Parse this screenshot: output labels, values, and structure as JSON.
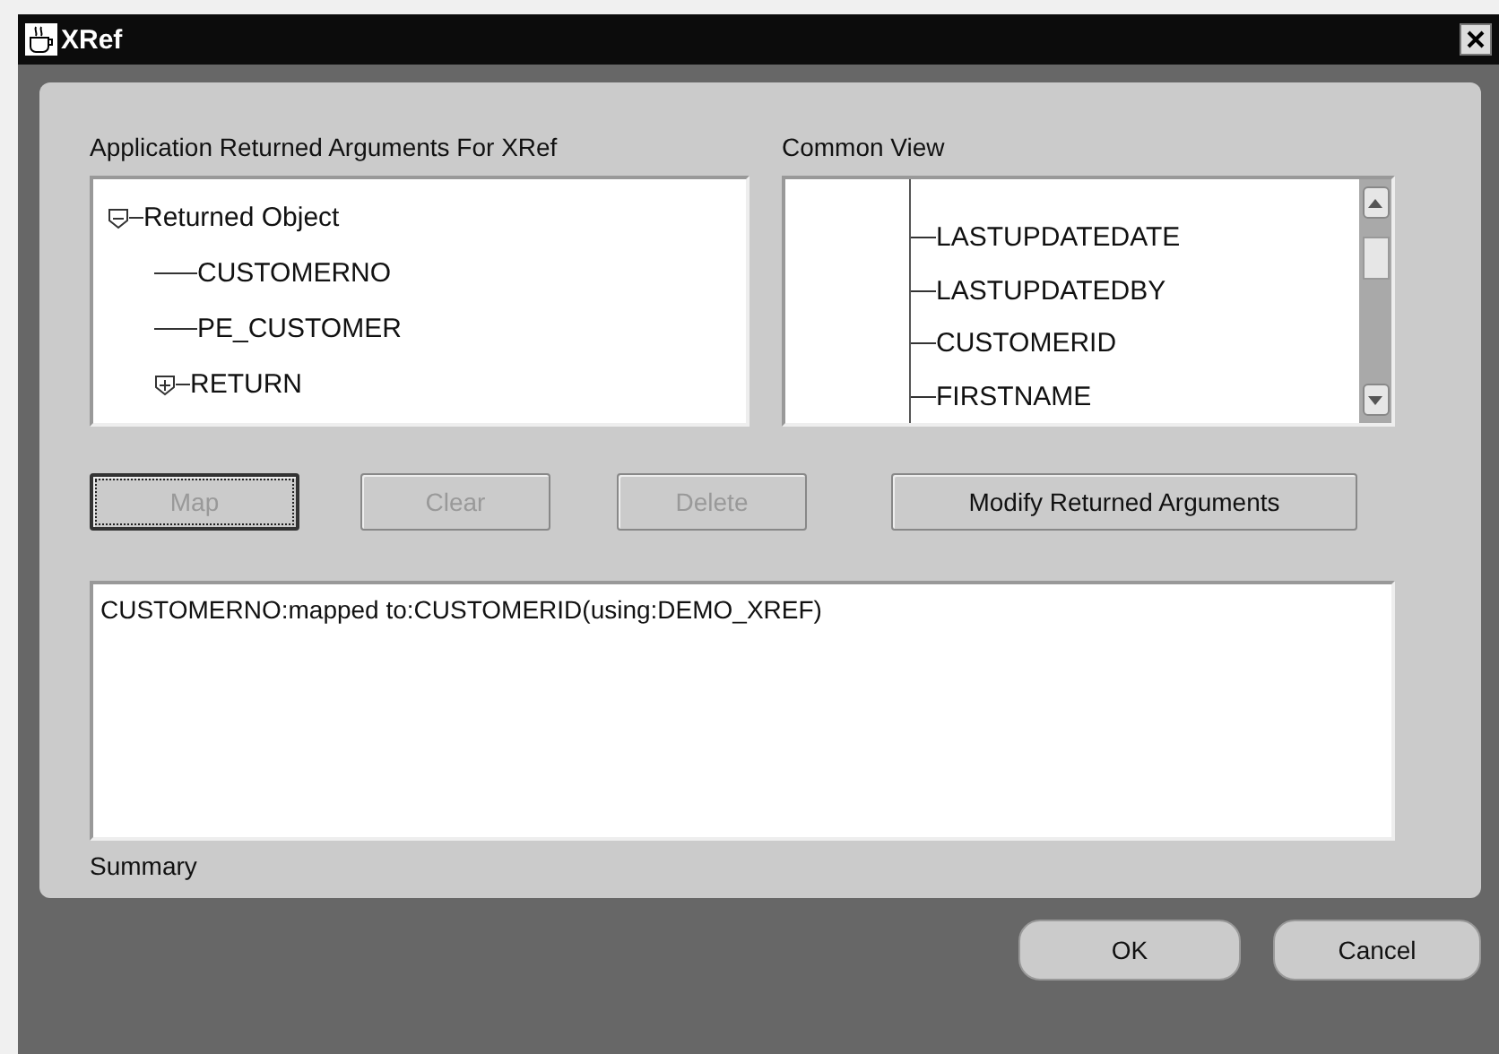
{
  "window": {
    "title": "XRef"
  },
  "left_tree": {
    "label": "Application Returned Arguments For XRef",
    "items": [
      {
        "label": "Returned Object",
        "kind": "folder",
        "expanded": true,
        "children": [
          {
            "label": "CUSTOMERNO",
            "kind": "leaf"
          },
          {
            "label": "PE_CUSTOMER",
            "kind": "leaf"
          },
          {
            "label": "RETURN",
            "kind": "folder",
            "expanded": false
          }
        ]
      }
    ]
  },
  "common_view": {
    "label": "Common View",
    "items": [
      {
        "label": "LASTUPDATEDATE"
      },
      {
        "label": "LASTUPDATEDBY"
      },
      {
        "label": "CUSTOMERID"
      },
      {
        "label": "FIRSTNAME"
      }
    ]
  },
  "actions": [
    {
      "label": "Map",
      "disabled": true,
      "focused": true
    },
    {
      "label": "Clear",
      "disabled": true,
      "focused": false
    },
    {
      "label": "Delete",
      "disabled": true,
      "focused": false
    },
    {
      "label": "Modify Returned Arguments",
      "disabled": false,
      "focused": false
    }
  ],
  "summary": {
    "label": "Summary",
    "value": "CUSTOMERNO:mapped to:CUSTOMERID(using:DEMO_XREF)"
  },
  "buttons": [
    "OK",
    "Cancel"
  ]
}
